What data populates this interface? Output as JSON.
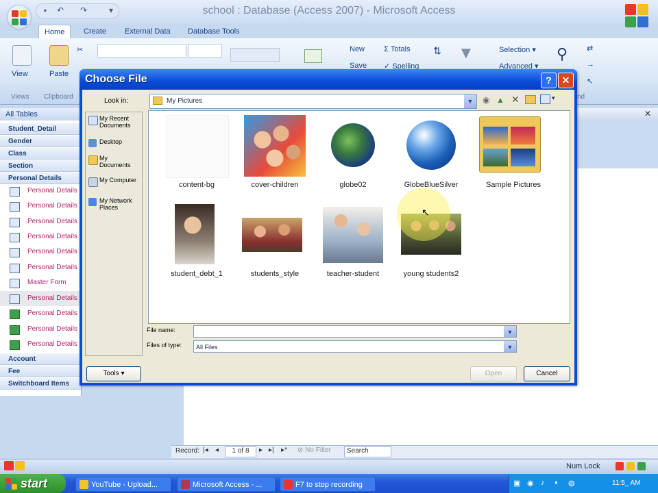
{
  "window": {
    "title": "school : Database (Access 2007) - Microsoft Access"
  },
  "ribbon": {
    "tabs": [
      "Home",
      "Create",
      "External Data",
      "Database Tools"
    ],
    "views_label": "View",
    "paste_label": "Paste",
    "new_label": "New",
    "save_label": "Save",
    "totals_label": "Totals",
    "spelling_label": "Spelling",
    "selection_label": "Selection",
    "advanced_label": "Advanced",
    "group_views": "Views",
    "group_clipboard": "Clipboard",
    "group_find": "nd"
  },
  "nav": {
    "header": "All Tables",
    "groups": [
      "Student_Detail",
      "Gender",
      "Class",
      "Section",
      "Personal Details"
    ],
    "items": [
      "Personal Details",
      "Personal Details",
      "Personal Details",
      "Personal Details",
      "Personal Details",
      "Personal Details",
      "Master Form",
      "Personal Details",
      "Personal Details",
      "Personal Details",
      "Personal Details"
    ],
    "bottom_groups": [
      "Account",
      "Fee",
      "Switchboard Items"
    ]
  },
  "dialog": {
    "title": "Choose File",
    "help_btn": "?",
    "close_btn": "✕",
    "look_in_label": "Look in:",
    "look_in_value": "My Pictures",
    "places": [
      "My Recent Documents",
      "Desktop",
      "My Documents",
      "My Computer",
      "My Network Places"
    ],
    "files": [
      {
        "name": "content-bg"
      },
      {
        "name": "cover-children"
      },
      {
        "name": "globe02"
      },
      {
        "name": "GlobeBlueSilver"
      },
      {
        "name": "Sample Pictures"
      },
      {
        "name": "student_debt_1"
      },
      {
        "name": "students_style"
      },
      {
        "name": "teacher-student"
      },
      {
        "name": "young students2"
      }
    ],
    "file_name_label": "File name:",
    "file_name_value": "",
    "files_of_type_label": "Files of type:",
    "files_of_type_value": "All Files",
    "tools_label": "Tools",
    "open_label": "Open",
    "cancel_label": "Cancel"
  },
  "record_nav": {
    "label": "Record:",
    "position": "1 of 8",
    "filter": "No Filter",
    "search": "Search"
  },
  "status": {
    "num_lock": "Num Lock"
  },
  "taskbar": {
    "start": "start",
    "tasks": [
      "YouTube - Upload...",
      "Microsoft Access - ...",
      "F7 to stop recording"
    ],
    "clock": "11:5_ AM"
  }
}
